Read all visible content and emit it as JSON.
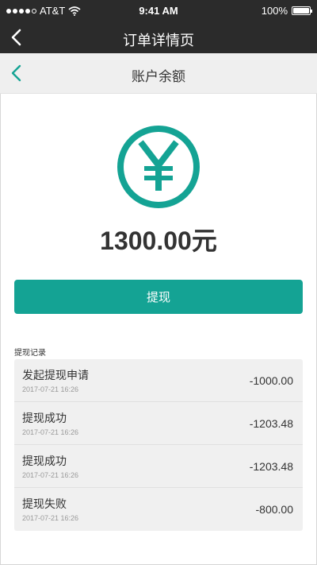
{
  "status_bar": {
    "carrier": "AT&T",
    "time": "9:41 AM",
    "battery": "100%"
  },
  "header": {
    "title": "订单详情页"
  },
  "subheader": {
    "title": "账户余额"
  },
  "balance": {
    "amount": "1300.00元",
    "icon": "yen-icon"
  },
  "withdraw_button": {
    "label": "提现"
  },
  "records": {
    "label": "提现记录",
    "items": [
      {
        "title": "发起提现申请",
        "date": "2017-07-21  16:26",
        "amount": "-1000.00"
      },
      {
        "title": "提现成功",
        "date": "2017-07-21  16:26",
        "amount": "-1203.48"
      },
      {
        "title": "提现成功",
        "date": "2017-07-21  16:26",
        "amount": "-1203.48"
      },
      {
        "title": "提现失败",
        "date": "2017-07-21  16:26",
        "amount": "-800.00"
      }
    ]
  },
  "colors": {
    "accent": "#14a394",
    "header_bg": "#2b2b2b",
    "subheader_bg": "#efefef"
  }
}
